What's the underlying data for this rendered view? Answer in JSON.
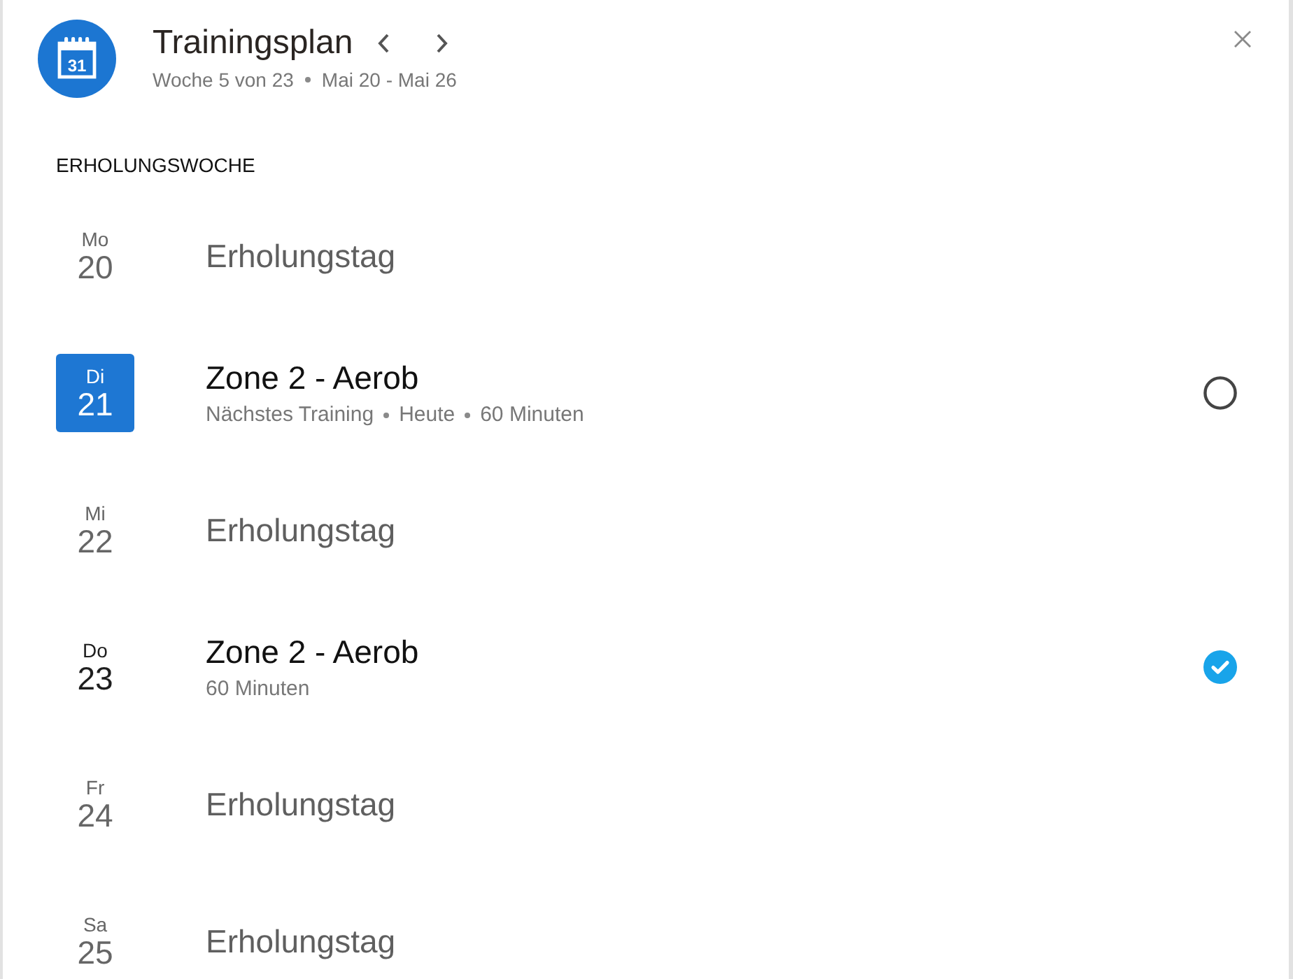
{
  "header": {
    "icon_label": "31",
    "title": "Trainingsplan",
    "week": "Woche 5 von 23",
    "range": "Mai 20 - Mai 26"
  },
  "section": "ERHOLUNGSWOCHE",
  "days": [
    {
      "weekday": "Mo",
      "date": "20",
      "today": false,
      "kind": "rest",
      "title": "Erholungstag"
    },
    {
      "weekday": "Di",
      "date": "21",
      "today": true,
      "kind": "workout",
      "title": "Zone 2 - Aerob",
      "details": [
        "Nächstes Training",
        "Heute",
        "60 Minuten"
      ],
      "completed": false
    },
    {
      "weekday": "Mi",
      "date": "22",
      "today": false,
      "kind": "rest",
      "title": "Erholungstag"
    },
    {
      "weekday": "Do",
      "date": "23",
      "today": false,
      "kind": "workout",
      "title": "Zone 2 - Aerob",
      "details": [
        "60 Minuten"
      ],
      "completed": true
    },
    {
      "weekday": "Fr",
      "date": "24",
      "today": false,
      "kind": "rest",
      "title": "Erholungstag"
    },
    {
      "weekday": "Sa",
      "date": "25",
      "today": false,
      "kind": "rest",
      "title": "Erholungstag"
    }
  ]
}
